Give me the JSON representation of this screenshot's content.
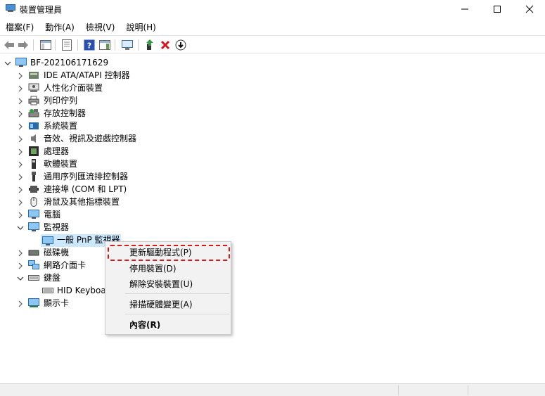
{
  "window": {
    "title": "裝置管理員"
  },
  "menu": [
    "檔案(F)",
    "動作(A)",
    "檢視(V)",
    "說明(H)"
  ],
  "tree": {
    "root": "BF-202106171629",
    "items": [
      {
        "label": "IDE ATA/ATAPI 控制器",
        "icon": "ide-controller-icon",
        "expanded": false
      },
      {
        "label": "人性化介面裝置",
        "icon": "hid-icon",
        "expanded": false
      },
      {
        "label": "列印佇列",
        "icon": "printer-icon",
        "expanded": false
      },
      {
        "label": "存放控制器",
        "icon": "storage-controller-icon",
        "expanded": false
      },
      {
        "label": "系統裝置",
        "icon": "system-device-icon",
        "expanded": false
      },
      {
        "label": "音效、視訊及遊戲控制器",
        "icon": "speaker-icon",
        "expanded": false
      },
      {
        "label": "處理器",
        "icon": "processor-icon",
        "expanded": false
      },
      {
        "label": "軟體裝置",
        "icon": "software-device-icon",
        "expanded": false
      },
      {
        "label": "通用序列匯流排控制器",
        "icon": "usb-icon",
        "expanded": false
      },
      {
        "label": "連接埠 (COM 和 LPT)",
        "icon": "port-icon",
        "expanded": false
      },
      {
        "label": "滑鼠及其他指標裝置",
        "icon": "mouse-icon",
        "expanded": false
      },
      {
        "label": "電腦",
        "icon": "computer-icon",
        "expanded": false
      },
      {
        "label": "監視器",
        "icon": "monitor-icon",
        "expanded": true
      },
      {
        "label": "一般 PnP 監視器",
        "icon": "monitor-icon",
        "child": true,
        "selected": true
      },
      {
        "label": "磁碟機",
        "icon": "disk-drive-icon",
        "expanded": false
      },
      {
        "label": "網路介面卡",
        "icon": "network-adapter-icon",
        "expanded": false
      },
      {
        "label": "鍵盤",
        "icon": "keyboard-icon",
        "expanded": true
      },
      {
        "label": "HID Keyboa",
        "icon": "keyboard-icon",
        "child": true
      },
      {
        "label": "顯示卡",
        "icon": "display-adapter-icon",
        "expanded": false
      }
    ]
  },
  "context_menu": {
    "update_driver": "更新驅動程式(P)",
    "disable_device": "停用裝置(D)",
    "uninstall_device": "解除安裝裝置(U)",
    "scan_hardware": "掃描硬體變更(A)",
    "properties": "內容(R)"
  },
  "colors": {
    "highlight": "#d61a1a",
    "selection": "#cce8ff"
  }
}
